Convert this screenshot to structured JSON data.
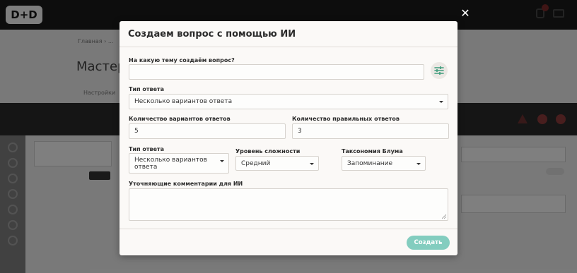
{
  "background": {
    "logo": "D+D",
    "logo_text": "",
    "breadcrumb": "Главная › ...",
    "page_title": "Мастер",
    "subtab": "Настройки",
    "panel_text": "",
    "right_label_1": "",
    "right_field_value": "",
    "right_label_2": "",
    "right_box_text": ""
  },
  "modal": {
    "title": "Создаем вопрос с помощью ИИ",
    "topic": {
      "label": "На какую тему создаём вопрос?",
      "value": ""
    },
    "answer_type": {
      "label": "Тип ответа",
      "value": "Несколько вариантов ответа"
    },
    "options_count": {
      "label": "Количество вариантов ответов",
      "value": "5"
    },
    "correct_count": {
      "label": "Количество правильных ответов",
      "value": "3"
    },
    "answer_type_2": {
      "label": "Тип ответа",
      "value_line1": "Несколько вариантов",
      "value_line2": "ответа"
    },
    "difficulty": {
      "label": "Уровень сложности",
      "value": "Средний"
    },
    "bloom": {
      "label": "Таксономия Блума",
      "value": "Запоминание"
    },
    "comments": {
      "label": "Уточняющие комментарии для ИИ",
      "value": ""
    },
    "create_label": "Создать",
    "close_icon": "close-icon",
    "settings_icon": "sliders-icon"
  },
  "colors": {
    "accent": "#83cdbf",
    "icon_green": "#3f9c7c",
    "modal_bg": "#fbf9f7"
  }
}
